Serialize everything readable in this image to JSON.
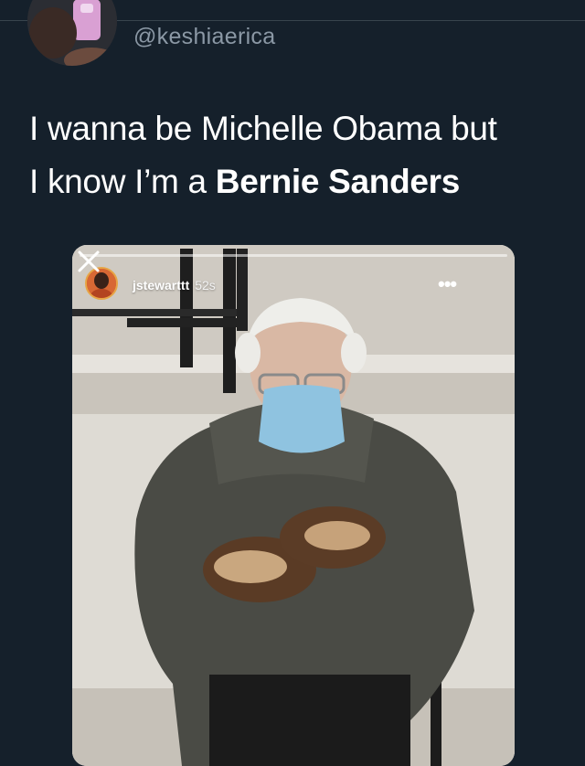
{
  "tweet": {
    "handle": "@keshiaerica",
    "text_line1": "I wanna be Michelle Obama but",
    "text_line2_prefix": "I know I’m a ",
    "text_line2_bold": "Bernie Sanders"
  },
  "story": {
    "username": "jstewarttt",
    "time": "52s",
    "more_icon": "ellipsis-icon",
    "close_icon": "close-icon"
  },
  "colors": {
    "background": "#15202b",
    "handle": "#8b98a5",
    "text": "#ffffff"
  }
}
